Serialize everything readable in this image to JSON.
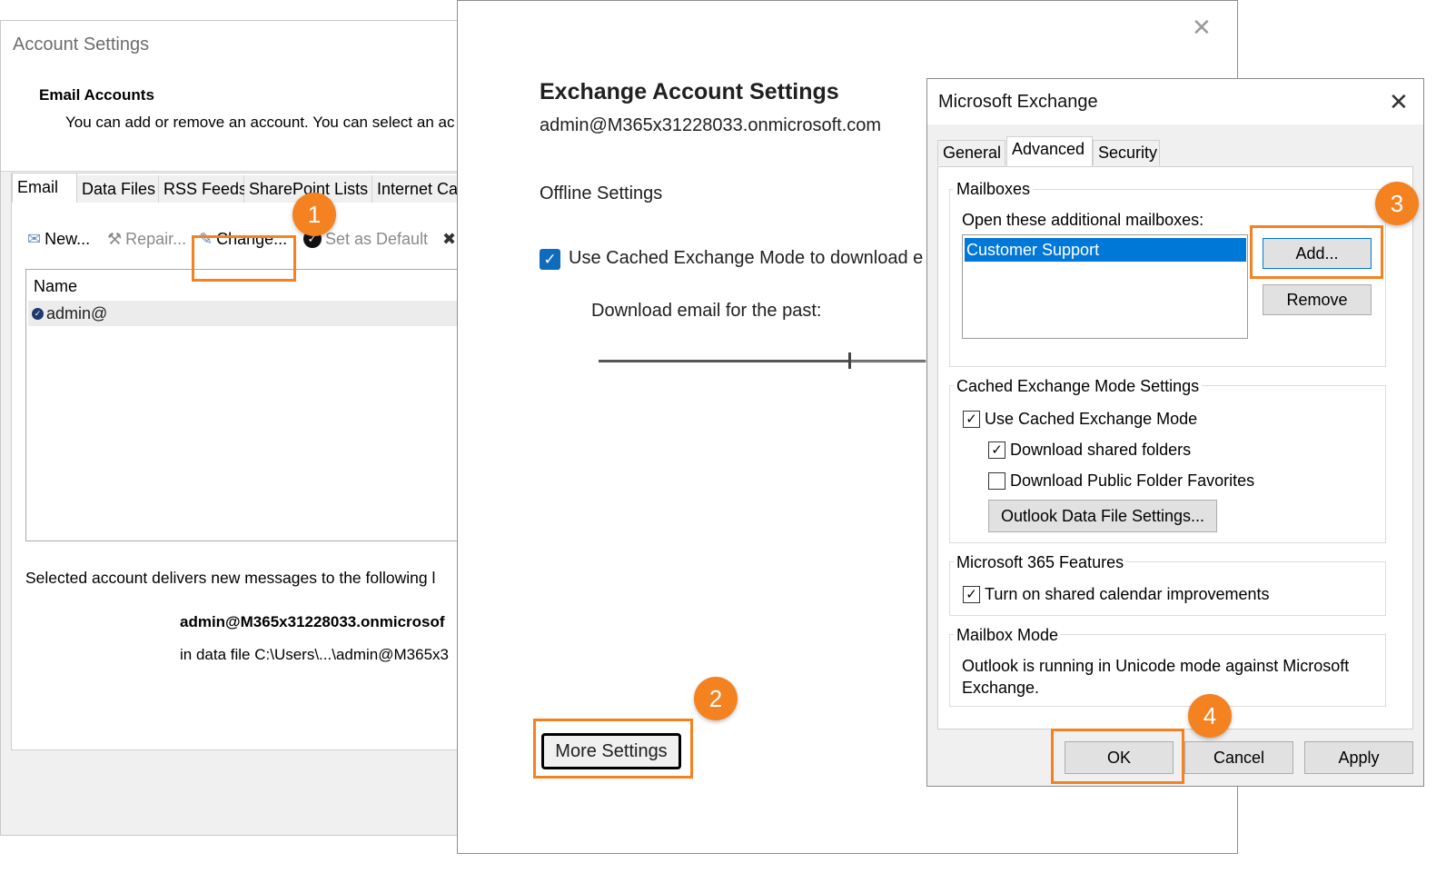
{
  "account_settings": {
    "title": "Account Settings",
    "heading": "Email Accounts",
    "description": "You can add or remove an account. You can select an ac",
    "tabs": [
      "Email",
      "Data Files",
      "RSS Feeds",
      "SharePoint Lists",
      "Internet Ca"
    ],
    "toolbar": {
      "new": "New...",
      "repair": "Repair...",
      "change": "Change...",
      "set_default": "Set as Default"
    },
    "list_header": "Name",
    "account": "admin@",
    "deliver_text": "Selected account delivers new messages to the following l",
    "deliver_email": "admin@M365x31228033.onmicrosof",
    "data_file": "in data file C:\\Users\\...\\admin@M365x3"
  },
  "exchange_settings": {
    "title": "Exchange Account Settings",
    "email": "admin@M365x31228033.onmicrosoft.com",
    "offline_label": "Offline Settings",
    "cached_mode": "Use Cached Exchange Mode to download e",
    "download_label": "Download email for the past:",
    "more_settings": "More Settings"
  },
  "ms_exchange": {
    "title": "Microsoft Exchange",
    "tabs": [
      "General",
      "Advanced",
      "Security"
    ],
    "mailboxes_group": "Mailboxes",
    "open_additional": "Open these additional mailboxes:",
    "mailbox_items": [
      "Customer Support"
    ],
    "add_button": "Add...",
    "remove_button": "Remove",
    "cached_group": "Cached Exchange Mode Settings",
    "use_cached": "Use Cached Exchange Mode",
    "download_shared": "Download shared folders",
    "download_public": "Download Public Folder Favorites",
    "data_file_settings": "Outlook Data File Settings...",
    "m365_group": "Microsoft 365 Features",
    "shared_calendar": "Turn on shared calendar improvements",
    "mailbox_mode_group": "Mailbox Mode",
    "mailbox_mode_text_1": "Outlook is running in Unicode mode against Microsoft",
    "mailbox_mode_text_2": "Exchange.",
    "ok": "OK",
    "cancel": "Cancel",
    "apply": "Apply"
  },
  "checks": {
    "use_cached": true,
    "download_shared": true,
    "download_public": false,
    "shared_calendar": true
  },
  "callouts": [
    "1",
    "2",
    "3",
    "4"
  ],
  "colors": {
    "callout": "#f58220",
    "selection": "#0078d7",
    "checkbox_accent": "#0f6cbd"
  }
}
